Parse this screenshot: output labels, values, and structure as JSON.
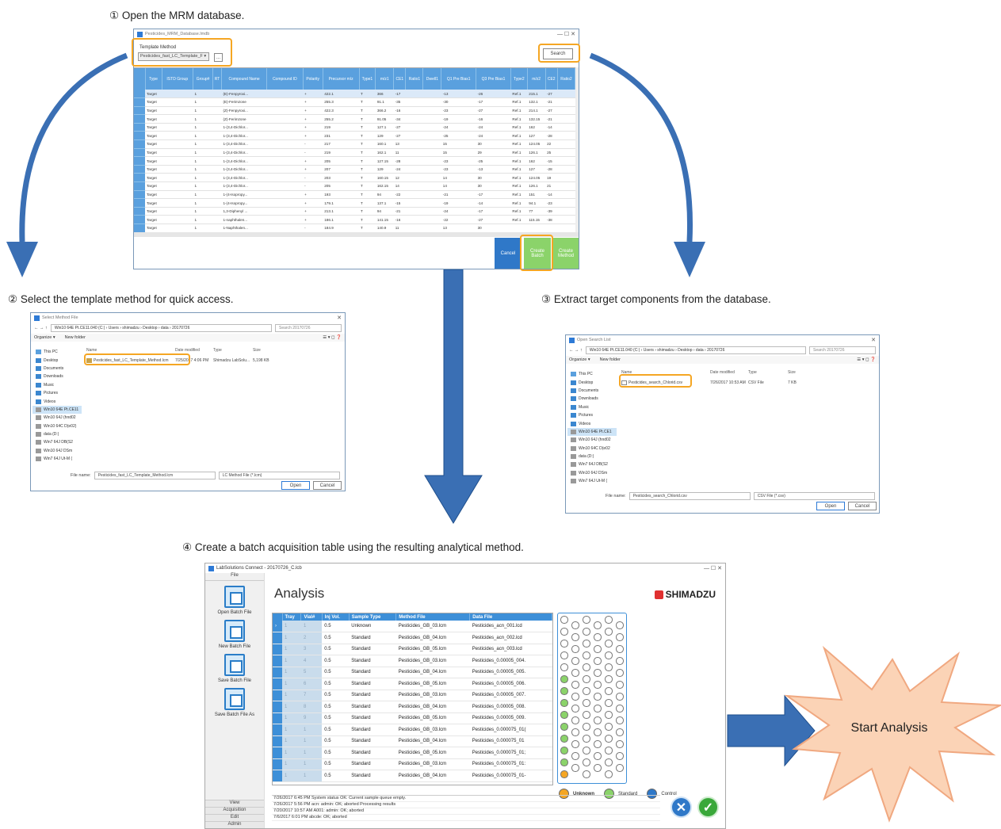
{
  "steps": {
    "s1": "① Open the MRM database.",
    "s2": "② Select the template method for quick access.",
    "s3": "③ Extract target components from the database.",
    "s4": "④ Create a batch acquisition table using the resulting analytical method."
  },
  "mrm_window": {
    "title": "Pesticides_MRM_Database.lmdb",
    "template_label": "Template Method",
    "template_value": "Pesticides_fast_LC_Template_F",
    "browse": "...",
    "search": "Search",
    "columns": [
      "Type",
      "ISTD Group",
      "Group#",
      "RT",
      "Compound Name",
      "Compound ID",
      "Polarity",
      "Precursor m/z",
      "Type1",
      "m/z1",
      "CE1",
      "Ratio1",
      "Dwell1",
      "Q1 Pre Bias1",
      "Q3 Pre Bias1",
      "Type2",
      "m/z2",
      "CE2",
      "Ratio2"
    ],
    "rows": [
      [
        "Target",
        "1",
        "(E)-Fenpyroxi...",
        "+",
        "422.1",
        "T",
        "366",
        "-17",
        "-13",
        "-26",
        "Ref.1",
        "215.1",
        "-27"
      ],
      [
        "Target",
        "1",
        "(E)-Ferimzone",
        "+",
        "255.3",
        "T",
        "91.1",
        "-35",
        "-30",
        "-17",
        "Ref.1",
        "132.1",
        "-21"
      ],
      [
        "Target",
        "1",
        "(Z)-Fenpyroxi...",
        "+",
        "422.3",
        "T",
        "366.2",
        "-16",
        "-23",
        "-27",
        "Ref.1",
        "214.1",
        "-27"
      ],
      [
        "Target",
        "1",
        "(Z)-Ferimzone",
        "+",
        "255.2",
        "T",
        "91.05",
        "-34",
        "-19",
        "-16",
        "Ref.1",
        "132.15",
        "-21"
      ],
      [
        "Target",
        "1",
        "1-(3,4-Dichlor...",
        "+",
        "219",
        "T",
        "127.1",
        "-27",
        "-24",
        "-24",
        "Ref.1",
        "162",
        "-14"
      ],
      [
        "Target",
        "1",
        "1-(3,4-Dichlor...",
        "+",
        "231",
        "T",
        "129",
        "-27",
        "-25",
        "-24",
        "Ref.1",
        "127",
        "-28"
      ],
      [
        "Target",
        "1",
        "1-(3,4-Dichlor...",
        "-",
        "217",
        "T",
        "160.1",
        "13",
        "15",
        "30",
        "Ref.1",
        "124.05",
        "22"
      ],
      [
        "Target",
        "1",
        "1-(3,4-Dichlor...",
        "-",
        "219",
        "T",
        "162.1",
        "11",
        "15",
        "29",
        "Ref.1",
        "126.1",
        "25"
      ],
      [
        "Target",
        "1",
        "1-(3,4-Dichlor...",
        "+",
        "205",
        "T",
        "127.15",
        "-28",
        "-23",
        "-25",
        "Ref.1",
        "162",
        "-15"
      ],
      [
        "Target",
        "1",
        "1-(3,4-Dichlor...",
        "+",
        "207",
        "T",
        "129",
        "-24",
        "-23",
        "-13",
        "Ref.1",
        "127",
        "-28"
      ],
      [
        "Target",
        "1",
        "1-(3,4-Dichlor...",
        "-",
        "203",
        "T",
        "160.15",
        "12",
        "14",
        "30",
        "Ref.1",
        "124.05",
        "19"
      ],
      [
        "Target",
        "1",
        "1-(3,4-Dichlor...",
        "-",
        "205",
        "T",
        "162.15",
        "14",
        "14",
        "30",
        "Ref.1",
        "126.1",
        "21"
      ],
      [
        "Target",
        "1",
        "1-(4-Isopropy...",
        "+",
        "193",
        "T",
        "94",
        "-22",
        "-21",
        "-17",
        "Ref.1",
        "151",
        "-14"
      ],
      [
        "Target",
        "1",
        "1-(4-Isopropy...",
        "+",
        "179.1",
        "T",
        "137.1",
        "-15",
        "-19",
        "-14",
        "Ref.1",
        "94.1",
        "-23"
      ],
      [
        "Target",
        "1",
        "1,3-Diphenyl ...",
        "+",
        "213.1",
        "T",
        "94",
        "-21",
        "-24",
        "-17",
        "Ref.1",
        "77",
        "-39"
      ],
      [
        "Target",
        "1",
        "1-naphthalen...",
        "+",
        "186.1",
        "T",
        "141.15",
        "-16",
        "-22",
        "-27",
        "Ref.1",
        "115.15",
        "-38"
      ],
      [
        "Target",
        "1",
        "1-Naphthalen...",
        "-",
        "184.9",
        "T",
        "140.9",
        "11",
        "13",
        "30",
        "",
        "",
        ""
      ]
    ],
    "cancel": "Cancel",
    "create_batch": "Create Batch",
    "create_method": "Create Method"
  },
  "open_method": {
    "title": "Select Method File",
    "path": "Win10 64E Pt.CE11.040 (C:) › Users › shimadzu › Desktop › data › 20170726",
    "search_ph": "Search 20170726",
    "organize": "Organize ▾",
    "new_folder": "New folder",
    "col_name": "Name",
    "col_date": "Date modified",
    "col_type": "Type",
    "col_size": "Size",
    "side": [
      "This PC",
      "Desktop",
      "Documents",
      "Downloads",
      "Music",
      "Pictures",
      "Videos",
      "Win10 64E Pt.CE11",
      "Win10 64J (hnd02",
      "Win10 64C D(e02)",
      "data (D:)",
      "Win7 64J DB(S2",
      "Win10 64J DSm",
      "Win7 64J Ut-M ("
    ],
    "file_name": "Pesticides_fast_LC_Template_Method.lcm",
    "file_date": "7/25/2017 4:06 PM",
    "file_type": "Shimadzu LabSolu...",
    "file_size": "5,198 KB",
    "filename_label": "File name:",
    "filename_value": "Pesticides_fast_LC_Template_Method.lcm",
    "filter": "LC Method File (*.lcm)",
    "open": "Open",
    "cancel": "Cancel"
  },
  "open_search": {
    "title": "Open Search List",
    "path": "Win10 64E Pt.CE11.040 (C:) › Users › shimadzu › Desktop › data › 20170726",
    "search_ph": "Search 20170726",
    "organize": "Organize ▾",
    "new_folder": "New folder",
    "col_name": "Name",
    "col_date": "Date modified",
    "col_type": "Type",
    "col_size": "Size",
    "side": [
      "This PC",
      "Desktop",
      "Documents",
      "Downloads",
      "Music",
      "Pictures",
      "Videos",
      "Win10 64E Pt.CE1",
      "Win10 64J (hnd02",
      "Win10 64C D(e02",
      "data (D:)",
      "Win7 64J DB(S2",
      "Win10 64J DSm",
      "Win7 64J Ut-M ("
    ],
    "file_name": "Pesticides_search_Chlorid.csv",
    "file_date": "7/26/2017 10:53 AM",
    "file_type": "CSV File",
    "file_size": "7 KB",
    "filename_label": "File name:",
    "filename_value": "Pesticides_search_Chlorid.csv",
    "filter": "CSV File (*.csv)",
    "open": "Open",
    "cancel": "Cancel"
  },
  "labsol": {
    "title": "LabSolutions Connect - 20170726_C.lcb",
    "menu_file": "File",
    "buttons": [
      "Open Batch File",
      "New Batch File",
      "Save Batch File",
      "Save Batch File As"
    ],
    "bottom_menu": [
      "View",
      "Acquisition",
      "Edit",
      "Admin"
    ],
    "heading": "Analysis",
    "brand": "SHIMADZU",
    "columns": [
      "Tray",
      "Vial#",
      "Inj Vol.",
      "Sample Type",
      "Method File",
      "Data File"
    ],
    "rows": [
      [
        "1",
        "1",
        "0.5",
        "Unknown",
        "Pesticides_GB_03.lcm",
        "Pesticides_acn_001.lcd"
      ],
      [
        "1",
        "2",
        "0.5",
        "Standard",
        "Pesticides_GB_04.lcm",
        "Pesticides_acn_002.lcd"
      ],
      [
        "1",
        "3",
        "0.5",
        "Standard",
        "Pesticides_GB_05.lcm",
        "Pesticides_acn_003.lcd"
      ],
      [
        "1",
        "4",
        "0.5",
        "Standard",
        "Pesticides_GB_03.lcm",
        "Pesticides_0.00005_004."
      ],
      [
        "1",
        "5",
        "0.5",
        "Standard",
        "Pesticides_GB_04.lcm",
        "Pesticides_0.00005_005."
      ],
      [
        "1",
        "6",
        "0.5",
        "Standard",
        "Pesticides_GB_05.lcm",
        "Pesticides_0.00005_006."
      ],
      [
        "1",
        "7",
        "0.5",
        "Standard",
        "Pesticides_GB_03.lcm",
        "Pesticides_0.00005_007."
      ],
      [
        "1",
        "8",
        "0.5",
        "Standard",
        "Pesticides_GB_04.lcm",
        "Pesticides_0.00005_008."
      ],
      [
        "1",
        "9",
        "0.5",
        "Standard",
        "Pesticides_GB_05.lcm",
        "Pesticides_0.00005_009."
      ],
      [
        "1",
        "1",
        "0.5",
        "Standard",
        "Pesticides_GB_03.lcm",
        "Pesticides_0.000075_01("
      ],
      [
        "1",
        "1",
        "0.5",
        "Standard",
        "Pesticides_GB_04.lcm",
        "Pesticides_0.000075_01"
      ],
      [
        "1",
        "1",
        "0.5",
        "Standard",
        "Pesticides_GB_05.lcm",
        "Pesticides_0.000075_01;"
      ],
      [
        "1",
        "1",
        "0.5",
        "Standard",
        "Pesticides_GB_03.lcm",
        "Pesticides_0.000075_01:"
      ],
      [
        "1",
        "1",
        "0.5",
        "Standard",
        "Pesticides_GB_04.lcm",
        "Pesticides_0.000075_01-"
      ]
    ],
    "legend": [
      "Unknown",
      "Standard",
      "Control"
    ],
    "log": [
      "7/26/2017 6:45 PM System status OK: Current sample queue empty.",
      "7/26/2017 5:56 PM acn: admin: OK; aborted Processing results",
      "7/20/2017 10:57 AM A001: admin: OK; aborted",
      "7/6/2017 6:01 PM abcde: OK; aborted"
    ],
    "colors": {
      "unknown": "#f5a623",
      "standard": "#8bd36a",
      "control": "#2f78c8",
      "header": "#3d8fd8"
    }
  },
  "start": "Start Analysis",
  "colors": {
    "arrow": "#3a6fb4",
    "highlight": "#f5a623",
    "star_fill": "#fbd3b6",
    "star_stroke": "#f0a880"
  }
}
